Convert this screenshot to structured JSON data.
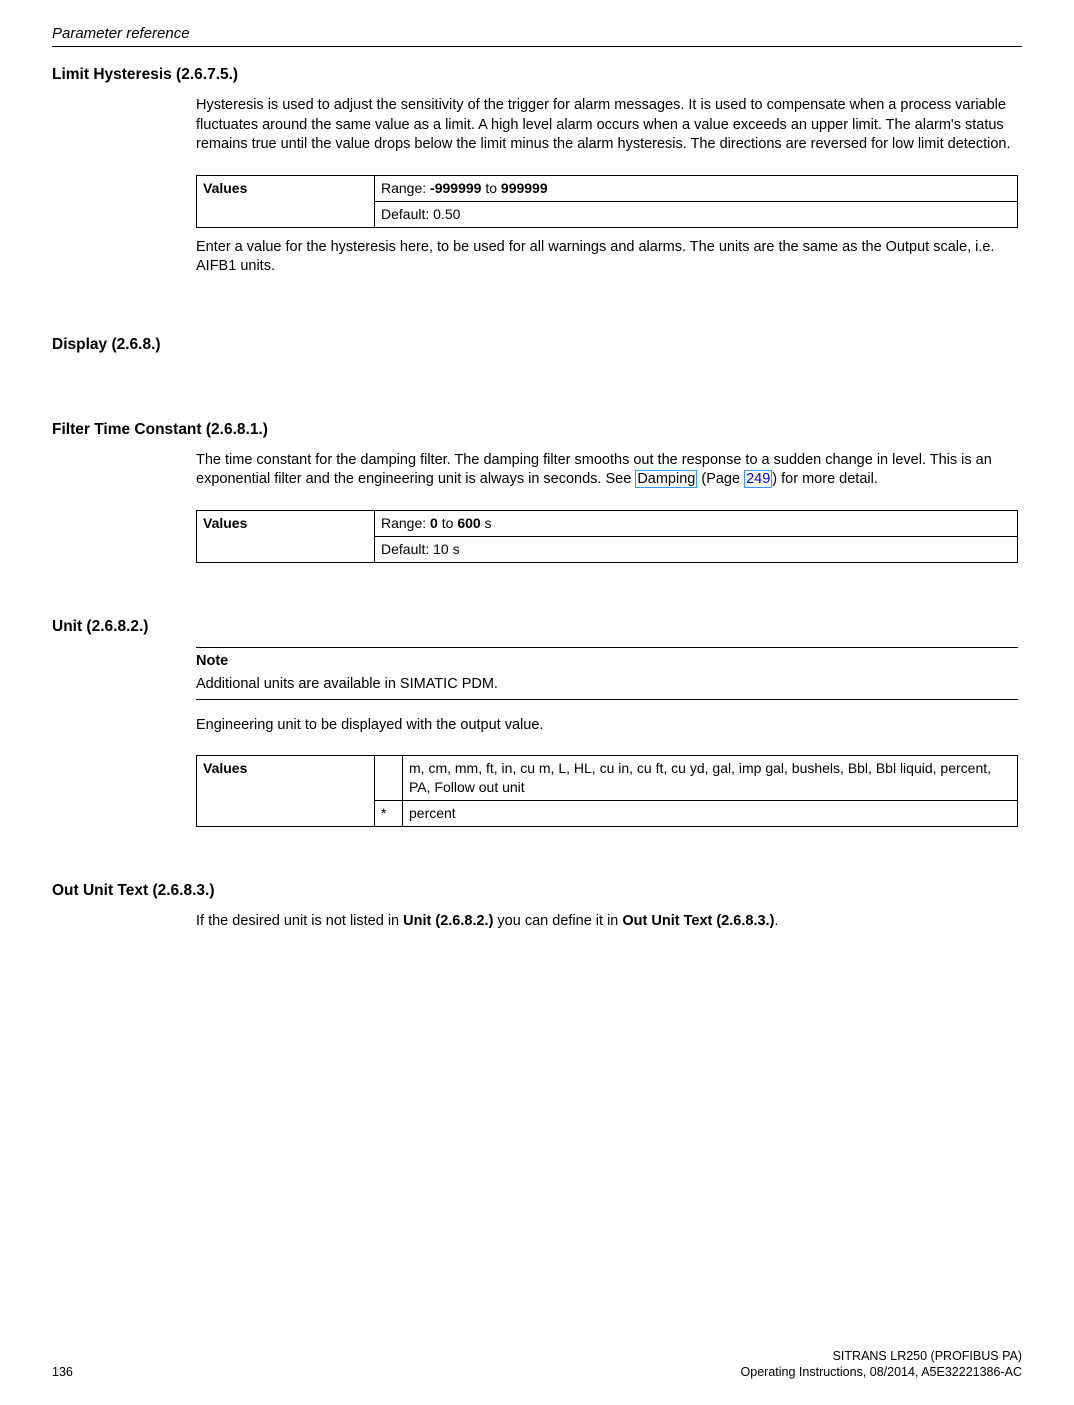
{
  "header": {
    "title": "Parameter reference"
  },
  "s1": {
    "heading": "Limit Hysteresis (2.6.7.5.)",
    "para1": "Hysteresis is used to adjust the sensitivity of the trigger for alarm messages. It is used to compensate when a process variable fluctuates around the same value as a limit. A high level alarm occurs when a value exceeds an upper limit. The alarm's status remains true until the value drops below the limit minus the alarm hysteresis. The directions are reversed for low limit detection.",
    "table": {
      "label": "Values",
      "row1a": "Range: ",
      "row1b1": "-999999",
      "row1mid": " to ",
      "row1b2": "999999",
      "row2": "Default: 0.50"
    },
    "para2": "Enter a value for the hysteresis here, to be used for all warnings and alarms. The units are the same as the Output scale, i.e. AIFB1 units."
  },
  "s2": {
    "heading": "Display (2.6.8.)"
  },
  "s3": {
    "heading": "Filter Time Constant (2.6.8.1.)",
    "para1a": "The time constant for the damping filter. The damping filter smooths out the response to a sudden change in level. This is an exponential filter and the engineering unit is always in seconds. See ",
    "link1": "Damping",
    "para1b": " (Page ",
    "link2": "249",
    "para1c": ") for more detail.",
    "table": {
      "label": "Values",
      "row1a": "Range: ",
      "row1b1": "0",
      "row1mid": " to ",
      "row1b2": "600",
      "row1suf": " s",
      "row2": "Default: 10 s"
    }
  },
  "s4": {
    "heading": "Unit (2.6.8.2.)",
    "noteHead": "Note",
    "noteBody": "Additional units are available in SIMATIC PDM.",
    "para1": "Engineering unit to be displayed with the output value.",
    "table": {
      "label": "Values",
      "row1": "m, cm, mm, ft, in, cu m, L, HL, cu in, cu ft, cu yd, gal, imp gal, bushels, Bbl, Bbl liquid, percent, PA, Follow out unit",
      "row2mark": "*",
      "row2": "percent"
    }
  },
  "s5": {
    "heading": "Out Unit Text (2.6.8.3.)",
    "para1a": "If the desired unit is not listed in ",
    "bold1": "Unit (2.6.8.2.)",
    "para1b": " you can define it in ",
    "bold2": "Out Unit Text (2.6.8.3.)",
    "para1c": "."
  },
  "footer": {
    "product": "SITRANS LR250 (PROFIBUS PA)",
    "page": "136",
    "doc": "Operating Instructions, 08/2014, A5E32221386-AC"
  }
}
